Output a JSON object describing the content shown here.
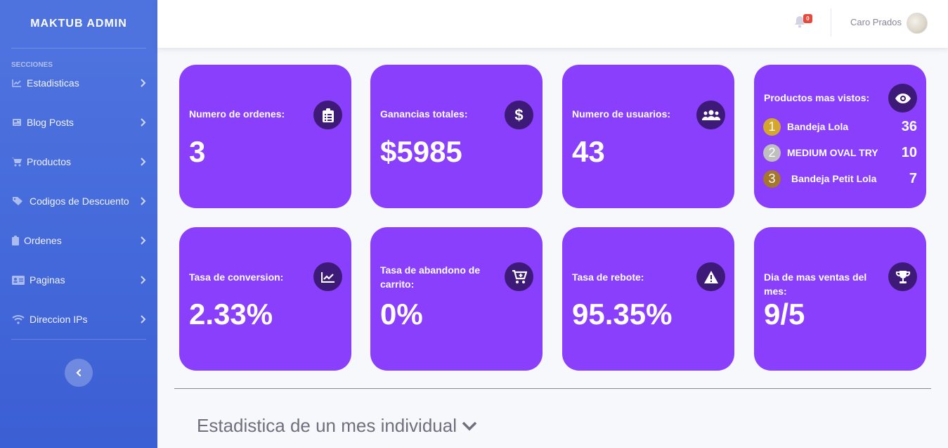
{
  "sidebar": {
    "brand": "MAKTUB ADMIN",
    "section_heading": "SECCIONES",
    "items": [
      {
        "label": "Estadisticas",
        "icon": "chart-area-icon"
      },
      {
        "label": "Blog Posts",
        "icon": "newspaper-icon"
      },
      {
        "label": "Productos",
        "icon": "shopping-cart-icon"
      },
      {
        "label": "Codigos de Descuento",
        "icon": "tags-icon"
      },
      {
        "label": "Ordenes",
        "icon": "clipboard-icon"
      },
      {
        "label": "Paginas",
        "icon": "id-card-icon"
      },
      {
        "label": "Direccion IPs",
        "icon": "wifi-icon"
      }
    ]
  },
  "topbar": {
    "notifications_count": "0",
    "user_name": "Caro Prados"
  },
  "cards": {
    "orders": {
      "label": "Numero de ordenes:",
      "value": "3",
      "icon": "clipboard-list-icon"
    },
    "earnings": {
      "label": "Ganancias totales:",
      "value": "$5985",
      "icon": "dollar-sign-icon"
    },
    "users": {
      "label": "Numero de usuarios:",
      "value": "43",
      "icon": "users-icon"
    },
    "top_products": {
      "label": "Productos mas vistos:",
      "icon": "eye-icon",
      "items": [
        {
          "rank": "1",
          "name": "Bandeja Lola",
          "count": "36",
          "medal_color": "#d4a72c"
        },
        {
          "rank": "2",
          "name": "MEDIUM OVAL TRY",
          "count": "10",
          "medal_color": "#bfbfbf"
        },
        {
          "rank": "3",
          "name": "Bandeja Petit Lola",
          "count": "7",
          "medal_color": "#a4772a"
        }
      ]
    },
    "conversion": {
      "label": "Tasa de conversion:",
      "value": "2.33%",
      "icon": "chart-line-icon"
    },
    "abandon": {
      "label": "Tasa de abandono de carrito:",
      "value": "0%",
      "icon": "cart-plus-icon"
    },
    "bounce": {
      "label": "Tasa de rebote:",
      "value": "95.35%",
      "icon": "exclamation-triangle-icon"
    },
    "best_day": {
      "label": "Dia de mas ventas del mes:",
      "value": "9/5",
      "icon": "trophy-icon"
    }
  },
  "section": {
    "title": "Estadistica de un mes individual"
  },
  "colors": {
    "card_bg": "#8a3ffc",
    "icon_bg": "#3d1a78",
    "sidebar": "#4e73df",
    "badge": "#e74a3b"
  }
}
